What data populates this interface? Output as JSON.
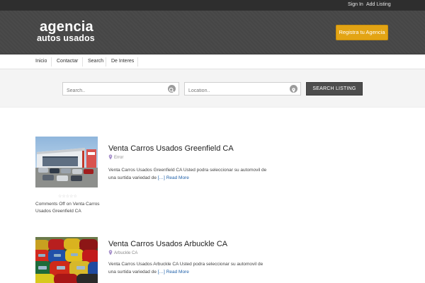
{
  "topbar": {
    "signin": "Sign In",
    "add_listing": "Add Listing"
  },
  "header": {
    "logo_line1": "agencia",
    "logo_line2": "autos usados",
    "cta_label": "Registra tu Agencia"
  },
  "nav": {
    "items": [
      "Inicio",
      "Contactar",
      "Search",
      "De Interes"
    ]
  },
  "search": {
    "keyword_placeholder": "Search..",
    "location_placeholder": "Location..",
    "button_label": "SEARCH LISTING"
  },
  "listings": [
    {
      "title": "Venta Carros Usados Greenfield CA",
      "location": "Error",
      "excerpt": "Venta Carros Usados Greenfield CA Usted podra seleccionar su automovil de una surtida variedad de",
      "ellipsis": "[…]",
      "read_more": "Read More",
      "rating": "☆☆☆☆☆",
      "comments": "Comments Off on Venta Carros Usados Greenfield CA"
    },
    {
      "title": "Venta Carros Usados Arbuckle CA",
      "location": "Arbuckle CA",
      "excerpt": "Venta Carros Usados Arbuckle CA Usted podra seleccionar su automovil de una surtida variedad de",
      "ellipsis": "[…]",
      "read_more": "Read More"
    }
  ],
  "colors": {
    "accent": "#e3a414",
    "header_bg": "#474747",
    "topbar_bg": "#2e2e2e",
    "link": "#1e5fa8"
  }
}
